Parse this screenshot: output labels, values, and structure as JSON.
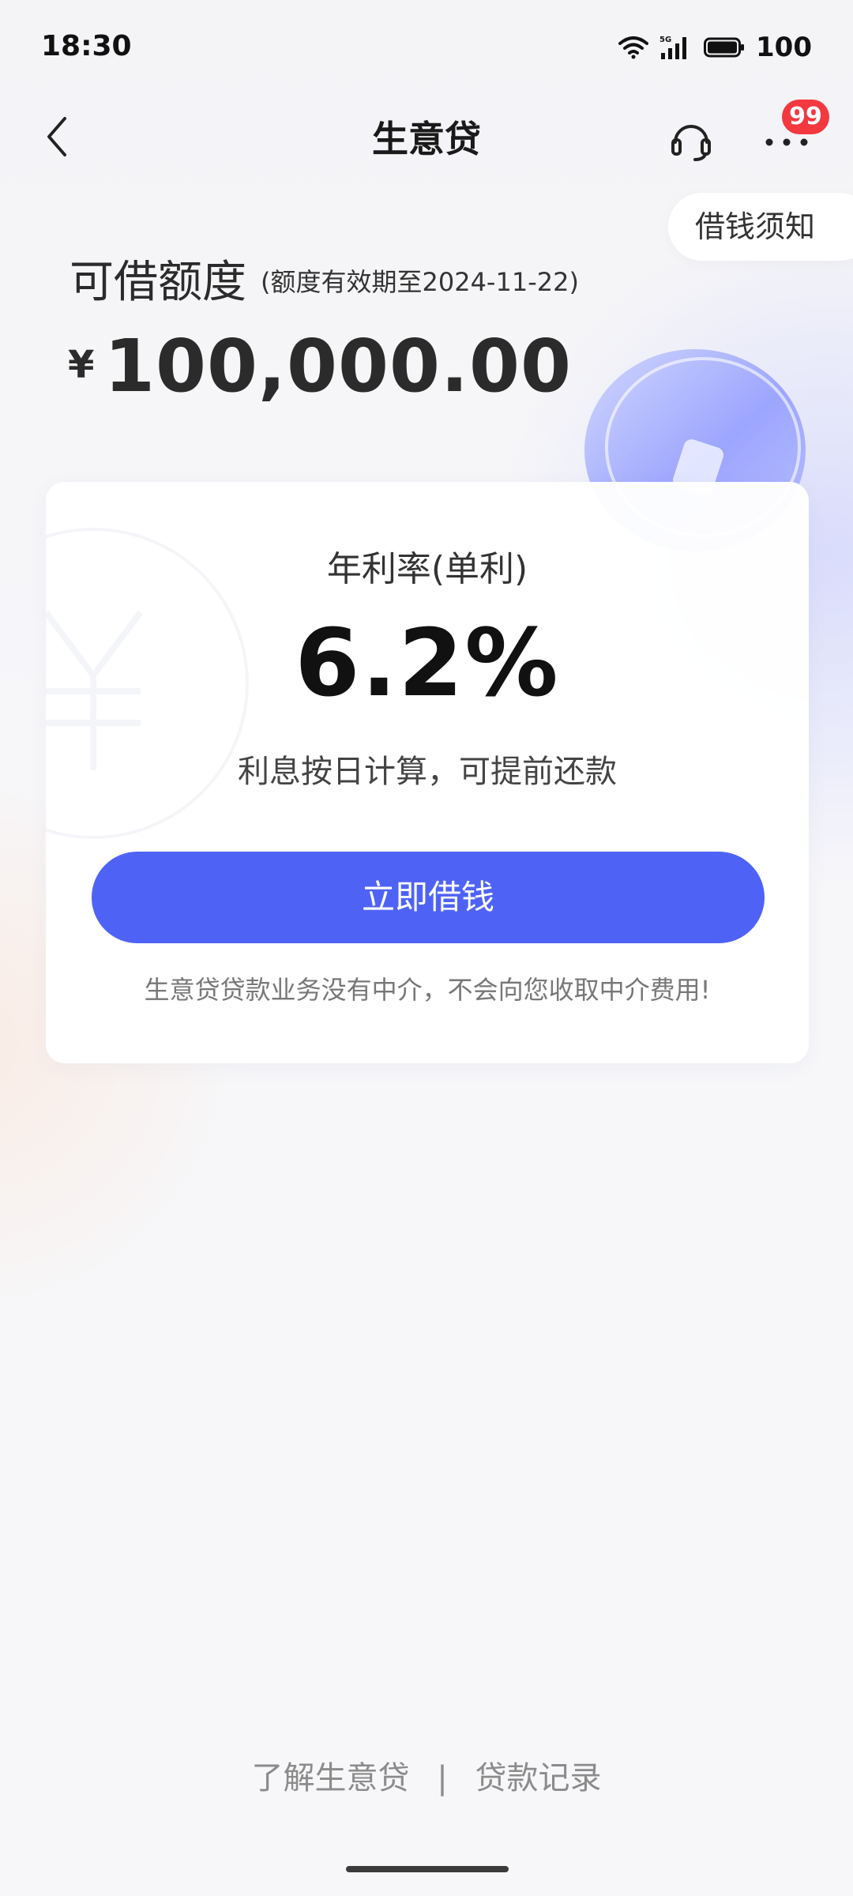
{
  "status_bar": {
    "time": "18:30",
    "network": "5G",
    "battery": "100"
  },
  "nav": {
    "title": "生意贷",
    "badge": "99"
  },
  "notice": "借钱须知",
  "quota": {
    "label": "可借额度",
    "validity": "(额度有效期至2024-11-22)",
    "currency": "¥",
    "amount": "100,000.00"
  },
  "card": {
    "rate_label": "年利率(单利)",
    "rate_value": "6.2%",
    "rate_desc": "利息按日计算，可提前还款",
    "button_label": "立即借钱",
    "footnote": "生意贷贷款业务没有中介，不会向您收取中介费用!"
  },
  "bottom_links": [
    "了解生意贷",
    "贷款记录"
  ],
  "bottom_divider": "|",
  "colors": {
    "primary": "#4e63f6",
    "badge": "#f3383f",
    "text_main": "#2b2b2b",
    "text_muted": "#8b8b8b"
  }
}
